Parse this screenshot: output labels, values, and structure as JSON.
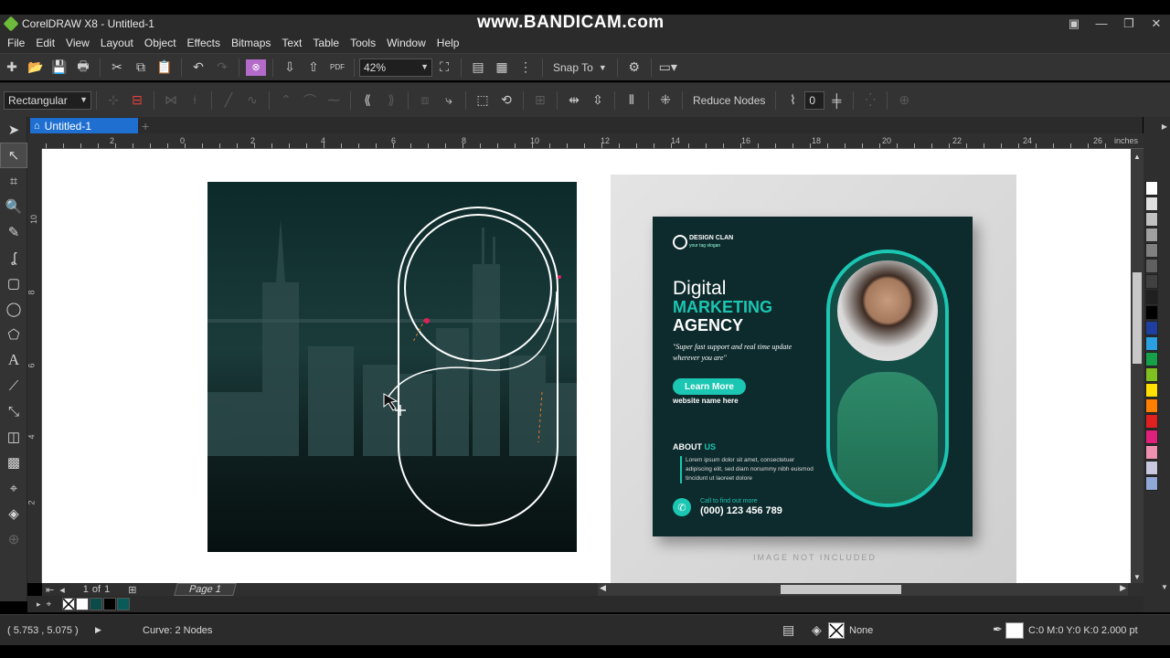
{
  "window": {
    "title": "CorelDRAW X8 - Untitled-1",
    "watermark": "www.BANDICAM.com",
    "controls": [
      "▣",
      "—",
      "❐",
      "✕"
    ]
  },
  "menu": [
    "File",
    "Edit",
    "View",
    "Layout",
    "Object",
    "Effects",
    "Bitmaps",
    "Text",
    "Table",
    "Tools",
    "Window",
    "Help"
  ],
  "toolbar1": {
    "zoom": "42%",
    "snap": "Snap To",
    "pdf_label": "PDF"
  },
  "toolbar2": {
    "shape_mode": "Rectangular",
    "reduce_nodes": "Reduce Nodes",
    "smoothing_value": "0"
  },
  "doc_tab": {
    "name": "Untitled-1"
  },
  "ruler": {
    "unit": "inches",
    "h_ticks": [
      "2",
      "0",
      "2",
      "4",
      "6",
      "8",
      "10",
      "12",
      "14",
      "16",
      "18",
      "20",
      "22",
      "24",
      "26"
    ],
    "v_ticks": [
      "10",
      "8",
      "6",
      "4",
      "2"
    ]
  },
  "flyer": {
    "brand": "DESIGN CLAN",
    "slogan": "your tag slogan",
    "headline1": "Digital",
    "headline2": "MARKETING",
    "headline3": "AGENCY",
    "quote": "\"Super fast support and real time update wherever you are\"",
    "button": "Learn More",
    "website": "website name here",
    "about_title_1": "ABOUT",
    "about_title_2": "US",
    "about_text": "Lorem ipsum dolor sit amet, consectetuer adipiscing elit, sed diam nonummy nibh euismod tincidunt ut laoreet dolore",
    "call_label": "Call to find out more",
    "phone": "(000) 123 456 789",
    "image_note": "IMAGE NOT INCLUDED"
  },
  "page_nav": {
    "current": "1",
    "of_label": "of",
    "total": "1",
    "page_tab": "Page 1"
  },
  "status": {
    "coords": "( 5.753 , 5.075 )",
    "object_info": "Curve: 2 Nodes",
    "fill": "None",
    "outline": "C:0 M:0 Y:0 K:0  2.000 pt"
  },
  "colors": {
    "accent": "#1e6fd0",
    "flyer_teal": "#1bc6b2",
    "palette": [
      "#ffffff",
      "#e0e0e0",
      "#c0c0c0",
      "#a0a0a0",
      "#808080",
      "#606060",
      "#404040",
      "#202020",
      "#000000",
      "#1e3fa0",
      "#2aa0e0",
      "#16a04a",
      "#80c020",
      "#ffe000",
      "#ff8000",
      "#e02020",
      "#e0207a",
      "#f090b0",
      "#c8c8e0",
      "#90a8d8"
    ]
  }
}
